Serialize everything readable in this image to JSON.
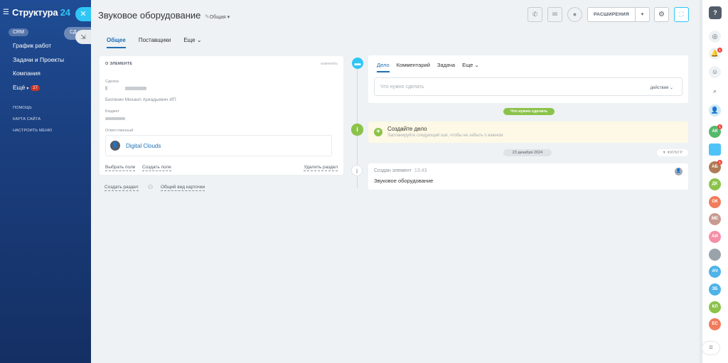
{
  "sidebar": {
    "brand_prefix": "Структура ",
    "brand_num": "24",
    "crm_label": "CRM",
    "pill_label": "СД",
    "nav": [
      "График работ",
      "Задачи и Проекты",
      "Компания",
      "Ещё"
    ],
    "more_badge": "27",
    "small_links": [
      "ПОМОЩЬ",
      "КАРТА САЙТА",
      "НАСТРОИТЬ МЕНЮ"
    ]
  },
  "header": {
    "title": "Звуковое оборудование",
    "category": "Общая",
    "extensions_label": "РАСШИРЕНИЯ"
  },
  "tabs": [
    "Общее",
    "Поставщики",
    "Еще"
  ],
  "about": {
    "heading": "О ЭЛЕМЕНТЕ",
    "edit_label": "изменить",
    "deal_label": "Сделка",
    "deal_text": "Белянин Михаил Аркадьевич ИП",
    "budget_label": "Бюджет",
    "responsible_label": "Ответственный",
    "responsible_name": "Digital Clouds",
    "select_field": "Выбрать поле",
    "create_field": "Создать поле",
    "delete_section": "Удалить раздел"
  },
  "bottom": {
    "create_section": "Создать раздел",
    "card_view": "Общий вид карточки"
  },
  "activity": {
    "tabs": [
      "Дело",
      "Комментарий",
      "Задача",
      "Еще"
    ],
    "placeholder": "Что нужно сделать",
    "actions_label": "действия"
  },
  "timeline": {
    "todo_pill": "Что нужно сделать",
    "create_title": "Создайте дело",
    "create_sub": "Запланируйте следующий шаг, чтобы не забыть о важном",
    "date_pill": "23 декабря 2024",
    "filter_label": "ФИЛЬТР",
    "event_title": "Создан элемент",
    "event_time": "13:43",
    "event_body": "Звуковое оборудование"
  },
  "rail": {
    "avatars": [
      {
        "initials": "АК",
        "color": "#55b96b"
      },
      {
        "initials": "",
        "color": "#4fc3f7"
      },
      {
        "initials": "АБ",
        "color": "#b07a56"
      },
      {
        "initials": "ДК",
        "color": "#8bc34a"
      },
      {
        "initials": "ОК",
        "color": "#f07c5b"
      },
      {
        "initials": "МЕ",
        "color": "#c99c91"
      },
      {
        "initials": "АИ",
        "color": "#f58fa8"
      },
      {
        "initials": "",
        "color": "#9aa3ab"
      },
      {
        "initials": "АЧ",
        "color": "#4fb3e8"
      },
      {
        "initials": "ЗБ",
        "color": "#4fb3e8"
      },
      {
        "initials": "КЛ",
        "color": "#8bc34a"
      },
      {
        "initials": "ЕС",
        "color": "#f07c5b"
      }
    ],
    "notif_badge": "1",
    "avatar1_badge": "1",
    "avatar3_badge": "1"
  }
}
